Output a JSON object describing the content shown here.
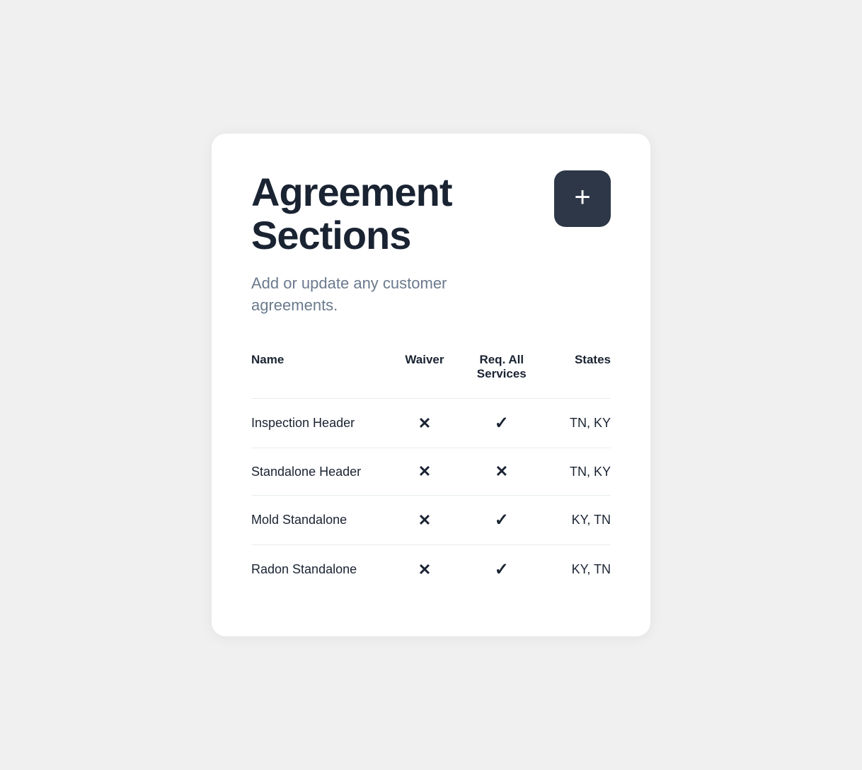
{
  "page": {
    "title_line1": "Agreement",
    "title_line2": "Sections",
    "subtitle": "Add or update any customer agreements.",
    "add_button_label": "+"
  },
  "table": {
    "columns": {
      "name": "Name",
      "waiver": "Waiver",
      "req_all_services": "Req. All Services",
      "states": "States"
    },
    "rows": [
      {
        "name": "Inspection Header",
        "waiver": "cross",
        "req_all_services": "check",
        "states": "TN, KY"
      },
      {
        "name": "Standalone Header",
        "waiver": "cross",
        "req_all_services": "cross",
        "states": "TN, KY"
      },
      {
        "name": "Mold Standalone",
        "waiver": "cross",
        "req_all_services": "check",
        "states": "KY,  TN"
      },
      {
        "name": "Radon Standalone",
        "waiver": "cross",
        "req_all_services": "check",
        "states": "KY, TN"
      }
    ]
  },
  "icons": {
    "cross": "✕",
    "check": "✓",
    "plus": "+"
  }
}
